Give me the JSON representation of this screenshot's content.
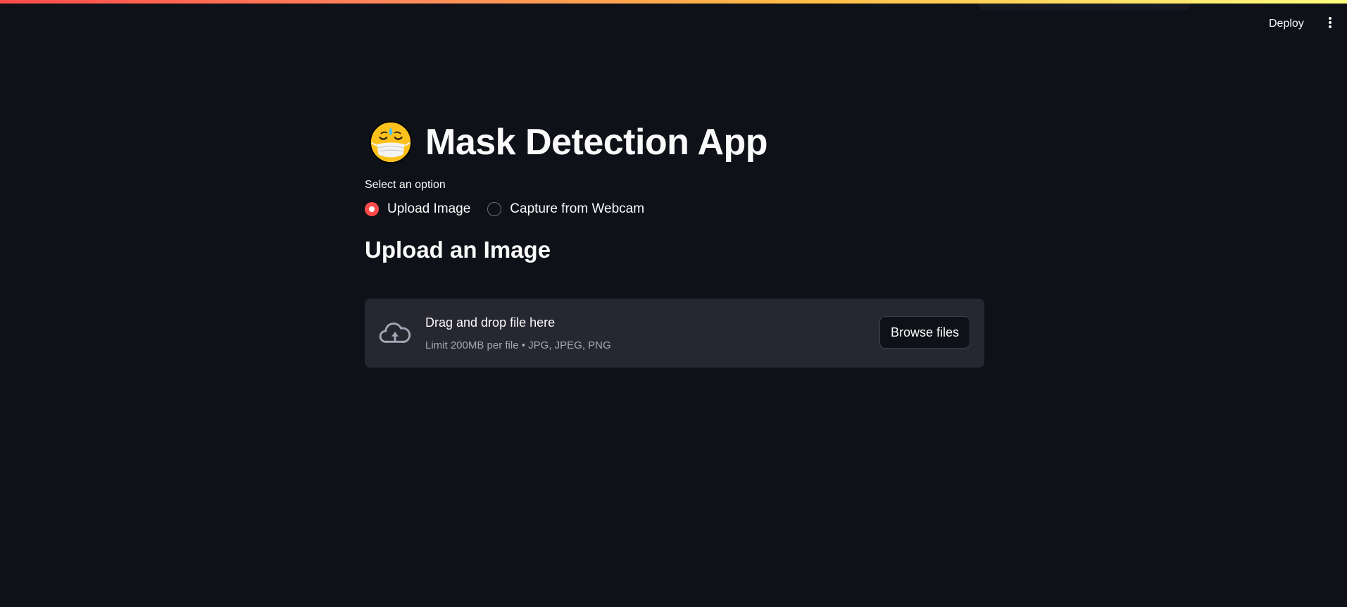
{
  "header": {
    "deploy_label": "Deploy",
    "menu_icon": "vertical-ellipsis-icon",
    "gradient_colors": [
      "#ff4b4b",
      "#ffbd45",
      "#fffd80"
    ]
  },
  "main": {
    "title": "Mask Detection App",
    "title_icon": "face-with-medical-mask-emoji",
    "radio_label": "Select an option",
    "radio_options": [
      {
        "label": "Upload Image",
        "selected": true
      },
      {
        "label": "Capture from Webcam",
        "selected": false
      }
    ],
    "section_heading": "Upload an Image",
    "uploader": {
      "icon": "cloud-upload-icon",
      "title": "Drag and drop file here",
      "subtitle": "Limit 200MB per file • JPG, JPEG, PNG",
      "button_label": "Browse files"
    }
  },
  "colors": {
    "background": "#0e1117",
    "accent": "#ff4b4b",
    "surface": "#262730",
    "text": "#fafafa",
    "muted_text": "#a3a8b8"
  }
}
